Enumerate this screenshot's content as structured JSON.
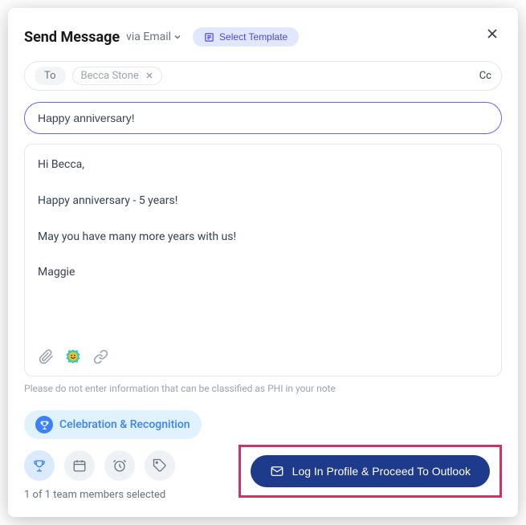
{
  "header": {
    "title": "Send Message",
    "via_label": "via Email",
    "template_button": "Select Template"
  },
  "recipients": {
    "to_label": "To",
    "chip_name": "Becca Stone",
    "cc_label": "Cc"
  },
  "subject": "Happy anniversary!",
  "body": "Hi Becca,\n\nHappy anniversary - 5 years!\n\nMay you have many more years with us!\n\nMaggie",
  "phi_warning": "Please do not enter information that can be classified as PHI in your note",
  "tag": {
    "label": "Celebration & Recognition"
  },
  "footer": {
    "selected_text": "1 of 1 team members selected",
    "proceed_label": "Log In Profile & Proceed To Outlook"
  }
}
